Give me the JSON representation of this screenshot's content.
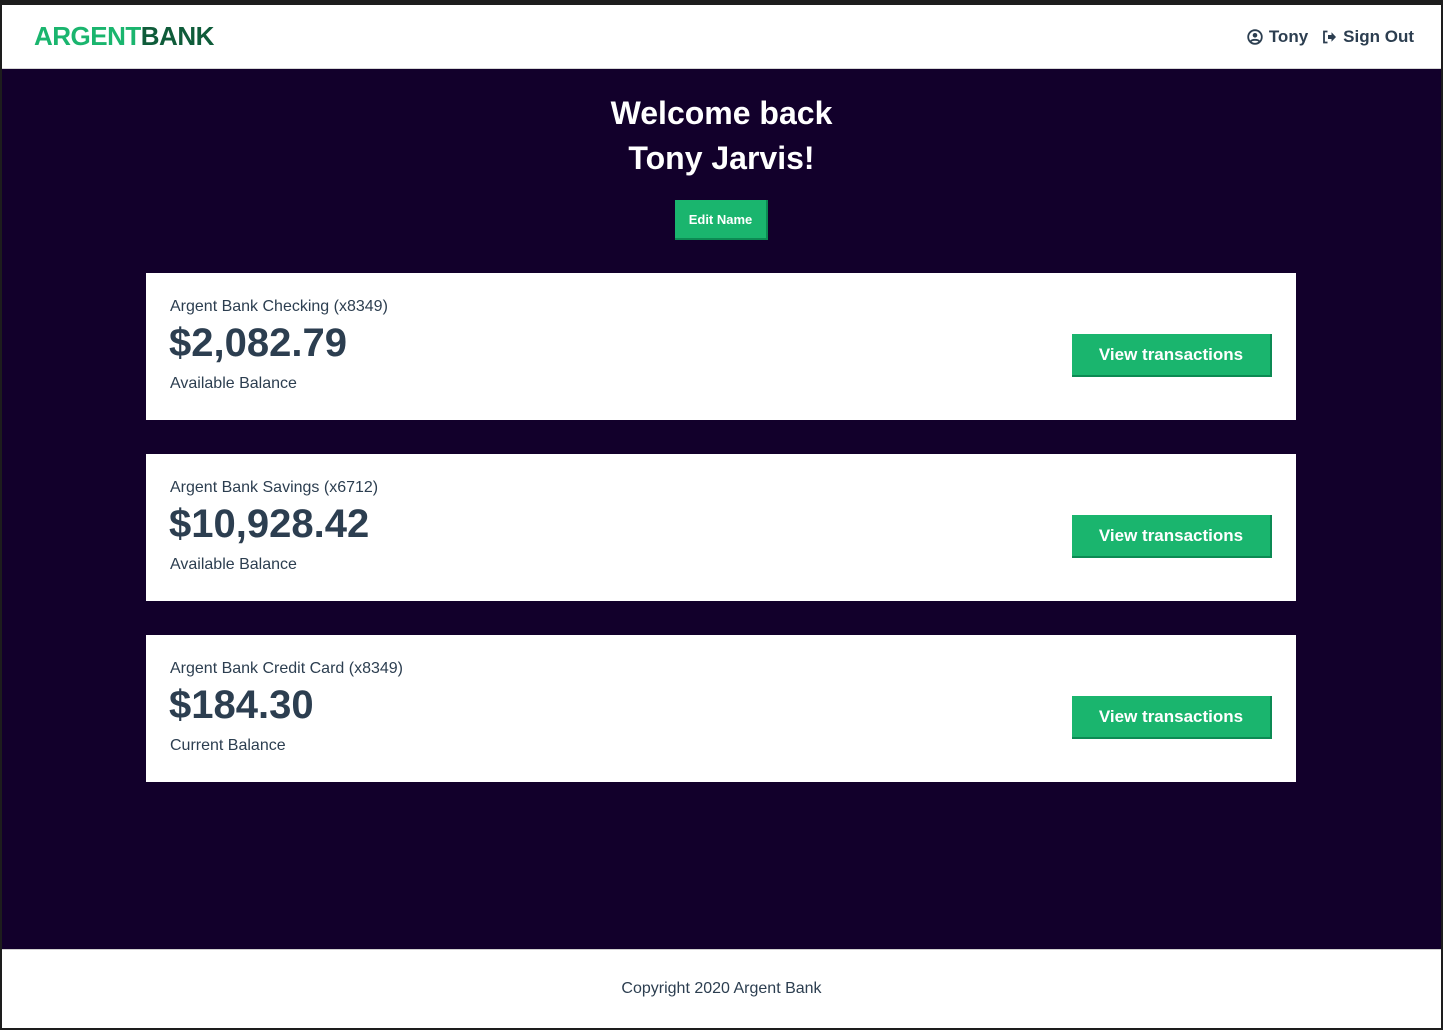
{
  "header": {
    "logo_part1": "ARGENT",
    "logo_part2": "BANK",
    "user_name": "Tony",
    "sign_out_label": "Sign Out"
  },
  "welcome": {
    "line1": "Welcome back",
    "line2": "Tony Jarvis!",
    "edit_button_label": "Edit Name"
  },
  "accounts": [
    {
      "title": "Argent Bank Checking (x8349)",
      "amount": "$2,082.79",
      "description": "Available Balance",
      "button_label": "View transactions"
    },
    {
      "title": "Argent Bank Savings (x6712)",
      "amount": "$10,928.42",
      "description": "Available Balance",
      "button_label": "View transactions"
    },
    {
      "title": "Argent Bank Credit Card (x8349)",
      "amount": "$184.30",
      "description": "Current Balance",
      "button_label": "View transactions"
    }
  ],
  "footer": {
    "copyright": "Copyright 2020 Argent Bank"
  },
  "colors": {
    "accent": "#1ab56e",
    "accent_dark": "#0f5c3a",
    "background": "#12002b",
    "text": "#2c3e50"
  },
  "icons": {
    "user": "user-circle-icon",
    "sign_out": "sign-out-icon"
  }
}
